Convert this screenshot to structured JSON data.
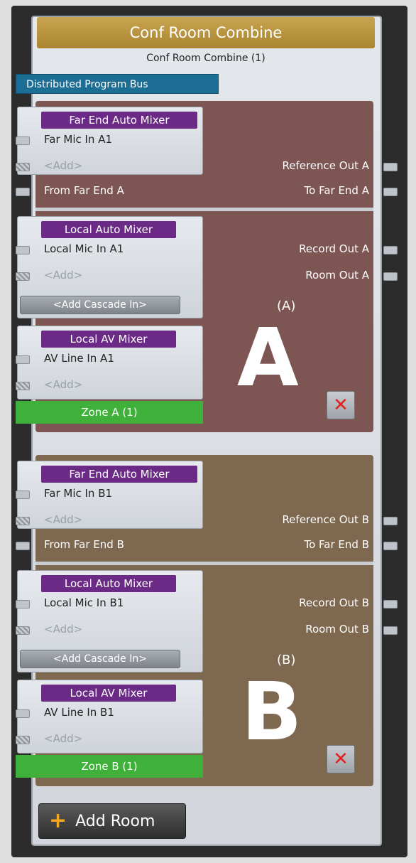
{
  "module": {
    "title": "Conf Room Combine",
    "subtitle": "Conf Room Combine (1)",
    "bus_tag": "Distributed Program Bus",
    "add_room_label": "Add Room"
  },
  "rooms": [
    {
      "far_end_mixer": {
        "header": "Far End Auto Mixer",
        "input": "Far Mic In A1",
        "add": "<Add>"
      },
      "reference_out": "Reference Out A",
      "from_far_end": "From Far End A",
      "to_far_end": "To Far End A",
      "local_auto_mixer": {
        "header": "Local Auto Mixer",
        "input": "Local Mic In A1",
        "add": "<Add>",
        "cascade": "<Add Cascade In>"
      },
      "record_out": "Record Out A",
      "room_out": "Room Out A",
      "room_label": "(A)",
      "av_mixer": {
        "header": "Local AV Mixer",
        "input": "AV Line In A1",
        "add": "<Add>"
      },
      "zone": "Zone A (1)",
      "letter": "A",
      "bg_color": "#7d5553"
    },
    {
      "far_end_mixer": {
        "header": "Far End Auto Mixer",
        "input": "Far Mic In B1",
        "add": "<Add>"
      },
      "reference_out": "Reference Out B",
      "from_far_end": "From Far End B",
      "to_far_end": "To Far End B",
      "local_auto_mixer": {
        "header": "Local Auto Mixer",
        "input": "Local Mic In B1",
        "add": "<Add>",
        "cascade": "<Add Cascade In>"
      },
      "record_out": "Record Out B",
      "room_out": "Room Out B",
      "room_label": "(B)",
      "av_mixer": {
        "header": "Local AV Mixer",
        "input": "AV Line In B1",
        "add": "<Add>"
      },
      "zone": "Zone B (1)",
      "letter": "B",
      "bg_color": "#7e6850"
    }
  ],
  "icons": {
    "delete": "close-x-icon",
    "add": "plus-icon"
  },
  "colors": {
    "title_bar": "#b8953f",
    "bus_tag": "#1d6e95",
    "mixer_header": "#6a2a86",
    "zone": "#3fb03a",
    "delete_x": "#e12020"
  }
}
